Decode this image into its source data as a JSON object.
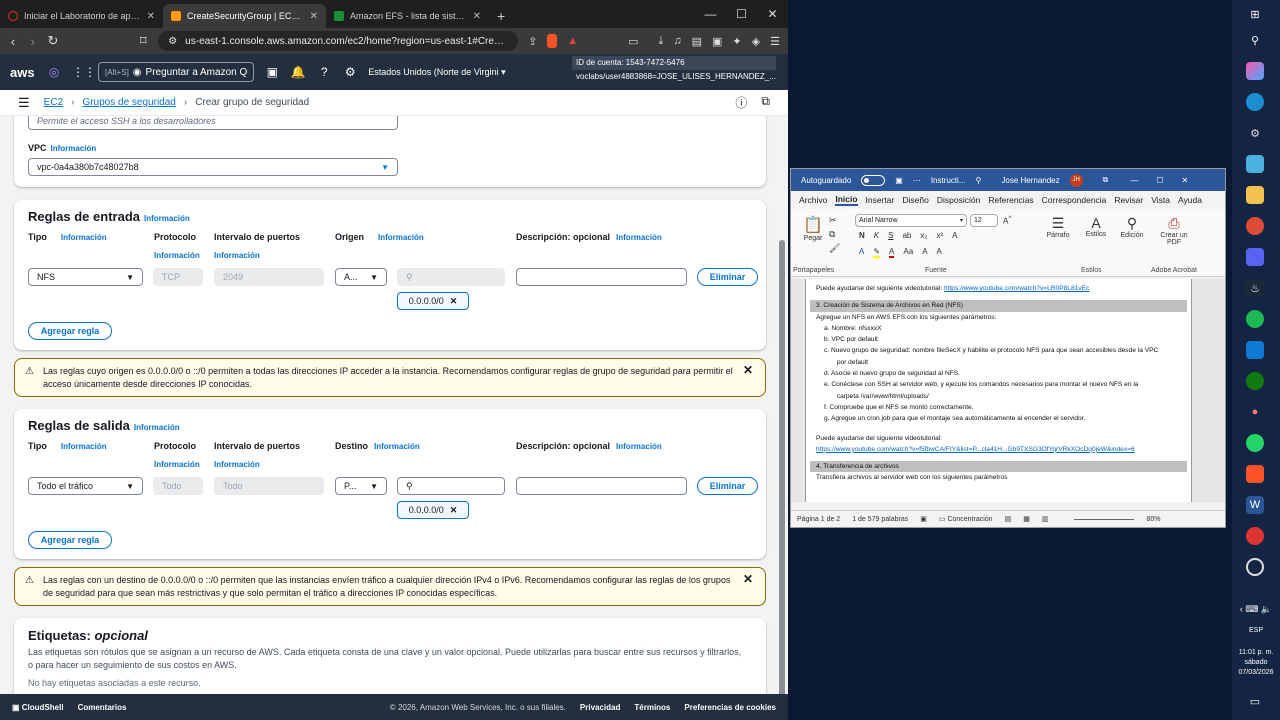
{
  "tabs": [
    {
      "title": "Iniciar el Laboratorio de aprendizaje",
      "color": "#e03030"
    },
    {
      "title": "CreateSecurityGroup | EC2 | us-e",
      "color": "#ff9900"
    },
    {
      "title": "Amazon EFS - lista de sistemas de ar",
      "color": "#1a8f3a"
    }
  ],
  "url": "us-east-1.console.aws.amazon.com/ec2/home?region=us-east-1#Create...",
  "aws": {
    "logo": "aws",
    "search_hint": "[Alt+S]",
    "q_label": "Preguntar a Amazon Q",
    "region": "Estados Unidos (Norte de Virgini",
    "account_id": "ID de cuenta: 1543-7472-5476",
    "account_user": "voclabs/user4883868=JOSE_ULISES_HERNANDEZ_..."
  },
  "breadcrumb": {
    "ec2": "EC2",
    "sg": "Grupos de seguridad",
    "current": "Crear grupo de seguridad"
  },
  "description_placeholder": "Permite el acceso SSH a los desarrolladores",
  "vpc": {
    "label": "VPC",
    "info": "Información",
    "value": "vpc-0a4a380b7c48027b8"
  },
  "inbound": {
    "title": "Reglas de entrada",
    "info": "Información",
    "col_tipo": "Tipo",
    "col_protocolo": "Protocolo",
    "col_puertos": "Intervalo de puertos",
    "col_origen": "Origen",
    "col_desc": "Descripción: opcional",
    "tipo": "NFS",
    "protocolo": "TCP",
    "puertos": "2049",
    "origen": "A...",
    "cidr": "0.0.0.0/0",
    "delete": "Eliminar",
    "add": "Agregar regla"
  },
  "warning_inbound": "Las reglas cuyo origen es 0.0.0.0/0 o ::/0 permiten a todas las direcciones IP acceder a la instancia. Recomendamos configurar reglas de grupo de seguridad para permitir el acceso únicamente desde direcciones IP conocidas.",
  "outbound": {
    "title": "Reglas de salida",
    "info": "Información",
    "col_tipo": "Tipo",
    "col_protocolo": "Protocolo",
    "col_puertos": "Intervalo de puertos",
    "col_destino": "Destino",
    "col_desc": "Descripción: opcional",
    "tipo": "Todo el tráfico",
    "protocolo": "Todo",
    "puertos": "Todo",
    "destino": "P...",
    "cidr": "0.0.0.0/0",
    "delete": "Eliminar",
    "add": "Agregar regla"
  },
  "warning_outbound": "Las reglas con un destino de 0.0.0.0/0 o ::/0 permiten que las instancias envíen tráfico a cualquier dirección IPv4 o IPv6. Recomendamos configurar las reglas de los grupos de seguridad para que sean más restrictivas y que solo permitan el tráfico a direcciones IP conocidas específicas.",
  "tags": {
    "title": "Etiquetas:",
    "title_opt": "opcional",
    "desc": "Las etiquetas son rótulos que se asignan a un recurso de AWS. Cada etiqueta consta de una clave y un valor opcional. Puede utilizarlas para buscar entre sus recursos y filtrarlos, o para hacer un seguimiento de sus costos en AWS.",
    "none": "No hay etiquetas asociadas a este recurso."
  },
  "footer": {
    "cloudshell": "CloudShell",
    "comments": "Comentarios",
    "copyright": "© 2026, Amazon Web Services, Inc. o sus filiales.",
    "privacy": "Privacidad",
    "terms": "Términos",
    "cookies": "Preferencias de cookies"
  },
  "word": {
    "autosave": "Autoguardado",
    "filename": "Instructi...",
    "user": "Jose Hernandez",
    "initials": "JH",
    "tabs": [
      "Archivo",
      "Inicio",
      "Insertar",
      "Diseño",
      "Disposición",
      "Referencias",
      "Correspondencia",
      "Revisar",
      "Vista",
      "Ayuda"
    ],
    "font": "Arial Narrow",
    "size": "12",
    "groups": {
      "clipboard": "Portapapeles",
      "font": "Fuente",
      "paragraph": "Párrafo",
      "styles": "Estilos",
      "editing": "Edición",
      "acrobat": "Adobe Acrobat"
    },
    "btns": {
      "paste": "Pegar",
      "paragraph": "Párrafo",
      "styles": "Estilos",
      "editing": "Edición",
      "pdf": "Crear un PDF"
    },
    "doc": {
      "l1": "Puede ayudarse del siguiente videotutorial:",
      "link1": "https://www.youtube.com/watch?v=LR0P8L81vEc",
      "sec3": "3.    Creación de Sistema de Archivos en Red (NFS)",
      "intro": "Agregue un NFS en AWS EFS con los siguientes parámetros:",
      "items": [
        "a.    Nombre: nfsxxxX",
        "b.    VPC por default",
        "c.    Nuevo grupo de seguridad: nombre fileSecX y habilite el protocolo NFS para que sean accesibles desde la VPC",
        "       por default",
        "d.    Asocie el nuevo grupo de seguridad al NFS.",
        "e.    Conéctese con SSH al servidor web, y ejecute los comandos necesarios para montar el nuevo NFS en la",
        "       carpeta /var/www/html/uploads/",
        "f.    Compruebe que el NFS se montó correctamente.",
        "g.    Agregue un cron job para que el montaje sea automáticamente al encender el servidor."
      ],
      "l2": "Puede ayudarse del siguiente videotutorial:",
      "link2": "https://www.youtube.com/watch?v=f5fbwCA/FtY&list=P...cla41H...Gb9TXSG3OfYqrVRkXOcDq0jeW&index=6",
      "sec4": "4.    Transferencia de archivos",
      "l3": "Transfiera archivos al servidor web con los siguientes parámetros"
    },
    "status": {
      "page": "Página 1 de 2",
      "words": "1 de 579 palabras",
      "focus": "Concentración",
      "zoom": "80%"
    }
  },
  "tray": {
    "lang": "ESP",
    "time": "11:01 p. m.",
    "day": "sábado",
    "date": "07/03/2026"
  }
}
